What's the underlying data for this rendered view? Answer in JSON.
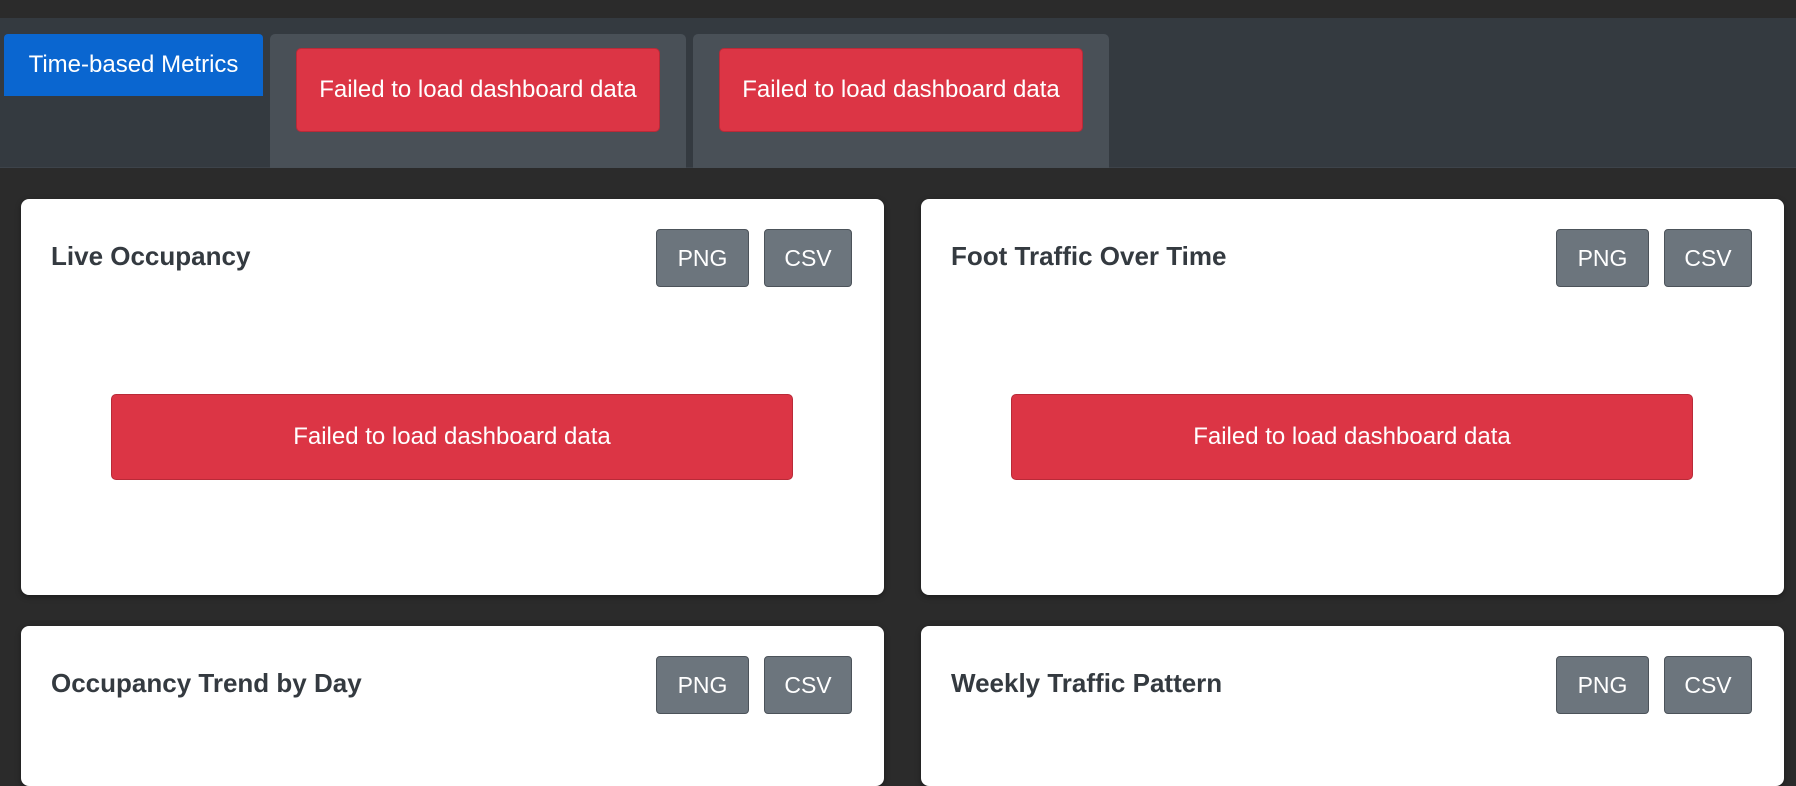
{
  "tabs": {
    "active_label": "Time-based Metrics",
    "panels": [
      {
        "error": "Failed to load dashboard data"
      },
      {
        "error": "Failed to load dashboard data"
      }
    ]
  },
  "cards": [
    {
      "title": "Live Occupancy",
      "png": "PNG",
      "csv": "CSV",
      "error": "Failed to load dashboard data"
    },
    {
      "title": "Foot Traffic Over Time",
      "png": "PNG",
      "csv": "CSV",
      "error": "Failed to load dashboard data"
    },
    {
      "title": "Occupancy Trend by Day",
      "png": "PNG",
      "csv": "CSV"
    },
    {
      "title": "Weekly Traffic Pattern",
      "png": "PNG",
      "csv": "CSV"
    }
  ],
  "colors": {
    "background": "#2b2b2b",
    "tabbar": "#343a40",
    "tab_active": "#0a66d0",
    "tab_panel": "#495057",
    "danger": "#dc3545",
    "secondary_button": "#6c757d",
    "card": "#ffffff",
    "card_title": "#343a40"
  }
}
